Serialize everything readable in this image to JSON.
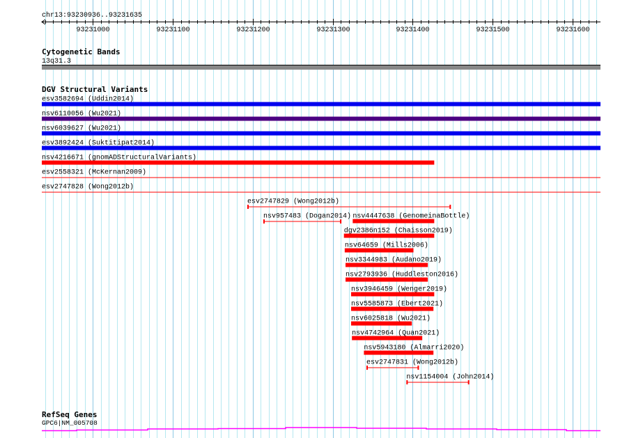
{
  "region": {
    "label": "chr13:93230936..93231635",
    "chrom": "chr13",
    "start": 93230936,
    "end": 93231635
  },
  "ruler": {
    "major_step": 100,
    "minor_step": 10,
    "labels": [
      "93231000",
      "93231100",
      "93231200",
      "93231300",
      "93231400",
      "93231500",
      "93231600"
    ]
  },
  "colors": {
    "grid_minor": "#b4e8f0",
    "grid_major": "#8cc8e4",
    "band": "#888888",
    "gene": "#ff00ff"
  },
  "cytoband": {
    "title": "Cytogenetic Bands",
    "label": "13q31.3"
  },
  "dgv": {
    "title": "DGV Structural Variants",
    "features": [
      {
        "label": "esv3582694 (Uddin2014)",
        "start": 93230936,
        "end": 93231635,
        "color": "#0000ee",
        "style": "thick"
      },
      {
        "label": "nsv6110056 (Wu2021)",
        "start": 93230936,
        "end": 93231635,
        "color": "#4b0082",
        "style": "thick"
      },
      {
        "label": "nsv6039627 (Wu2021)",
        "start": 93230936,
        "end": 93231635,
        "color": "#0000ee",
        "style": "thick"
      },
      {
        "label": "esv3892424 (Suktitipat2014)",
        "start": 93230936,
        "end": 93231635,
        "color": "#0000ee",
        "style": "thick"
      },
      {
        "label": "nsv4216671 (gnomADStructuralVariants)",
        "start": 93230936,
        "end": 93231427,
        "color": "#ff0000",
        "style": "thick"
      },
      {
        "label": "esv2558321 (McKernan2009)",
        "start": 93230936,
        "end": 93231635,
        "color": "#ff0000",
        "style": "line"
      },
      {
        "label": "esv2747828 (Wong2012b)",
        "start": 93230936,
        "end": 93231635,
        "color": "#ff0000",
        "style": "line"
      },
      {
        "label": "esv2747829 (Wong2012b)",
        "start": 93231194,
        "end": 93231447,
        "color": "#ff0000",
        "style": "capped",
        "row": 7
      },
      {
        "label": "nsv957483 (Dogan2014)",
        "start": 93231214,
        "end": 93231310,
        "color": "#ff0000",
        "style": "capped",
        "row": 8
      },
      {
        "label": "nsv4447638 (GenomeinaBottle)",
        "start": 93231325,
        "end": 93231427,
        "color": "#ff0000",
        "style": "thick",
        "row": 8
      },
      {
        "label": "dgv2386n152 (Chaisson2019)",
        "start": 93231314,
        "end": 93231427,
        "color": "#ff0000",
        "style": "thick",
        "row": 9
      },
      {
        "label": "nsv64659 (Mills2006)",
        "start": 93231315,
        "end": 93231401,
        "color": "#ff0000",
        "style": "thick",
        "row": 10
      },
      {
        "label": "nsv3344983 (Audano2019)",
        "start": 93231316,
        "end": 93231419,
        "color": "#ff0000",
        "style": "thick",
        "row": 11
      },
      {
        "label": "nsv2793936 (Huddleston2016)",
        "start": 93231316,
        "end": 93231419,
        "color": "#ff0000",
        "style": "thick",
        "row": 12
      },
      {
        "label": "nsv3946459 (Wenger2019)",
        "start": 93231323,
        "end": 93231427,
        "color": "#ff0000",
        "style": "thick",
        "row": 13
      },
      {
        "label": "nsv5585873 (Ebert2021)",
        "start": 93231323,
        "end": 93231426,
        "color": "#ff0000",
        "style": "thick",
        "row": 14
      },
      {
        "label": "nsv6025818 (Wu2021)",
        "start": 93231323,
        "end": 93231399,
        "color": "#ff0000",
        "style": "thick",
        "row": 15
      },
      {
        "label": "nsv4742964 (Quan2021)",
        "start": 93231324,
        "end": 93231412,
        "color": "#ff0000",
        "style": "thick",
        "row": 16
      },
      {
        "label": "nsv5943180 (Almarri2020)",
        "start": 93231339,
        "end": 93231426,
        "color": "#ff0000",
        "style": "thick",
        "row": 17
      },
      {
        "label": "esv2747831 (Wong2012b)",
        "start": 93231343,
        "end": 93231407,
        "color": "#ff0000",
        "style": "capped",
        "row": 18
      },
      {
        "label": "nsv1154004 (John2014)",
        "start": 93231393,
        "end": 93231470,
        "color": "#ff0000",
        "style": "capped",
        "row": 19
      }
    ]
  },
  "refseq": {
    "title": "RefSeq Genes",
    "label": "GPC6|NM_005708"
  }
}
